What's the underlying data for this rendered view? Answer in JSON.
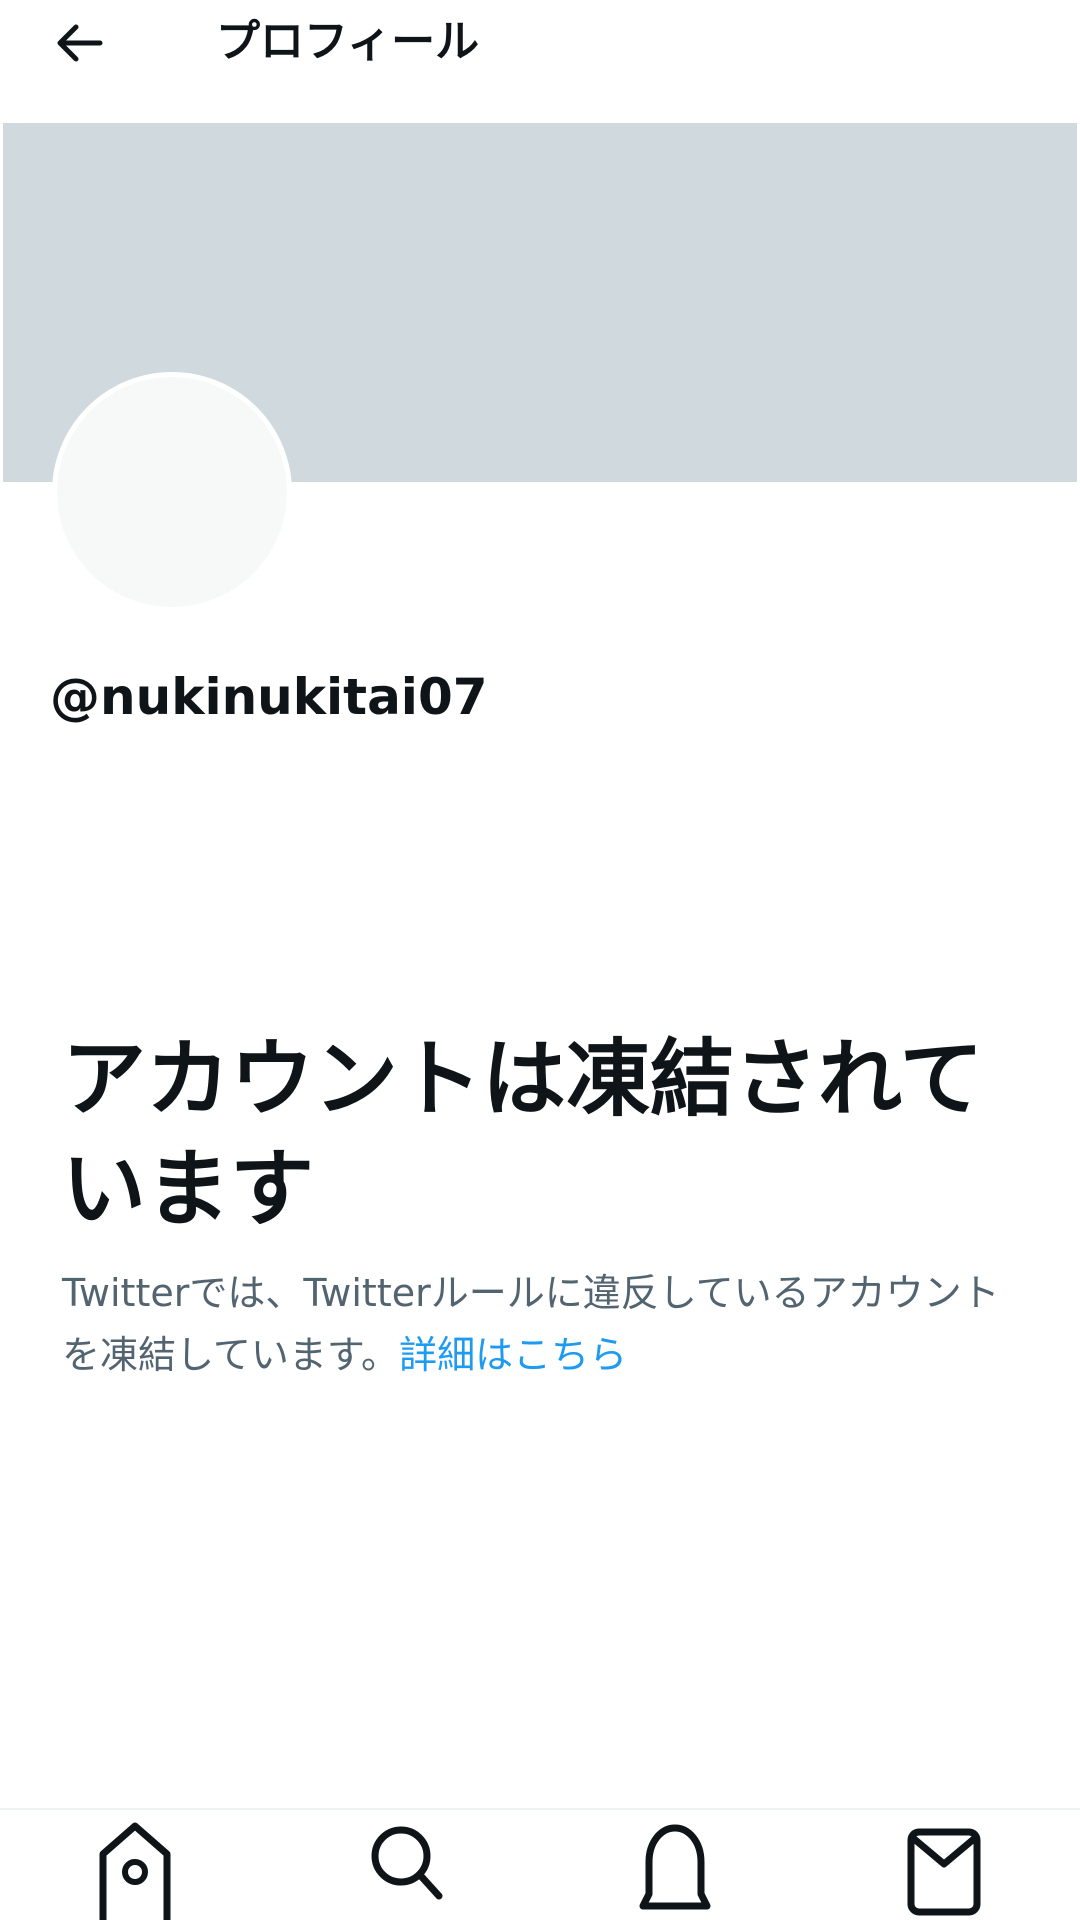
{
  "header": {
    "back_icon": "arrow-left-icon",
    "title": "プロフィール"
  },
  "profile": {
    "handle": "@nukinukitai07"
  },
  "suspension": {
    "title": "アカウントは凍結されています",
    "description": "Twitterでは、Twitterルールに違反しているアカウントを凍結しています。",
    "link_label": "詳細はこちら"
  },
  "bottom_nav": {
    "items": [
      {
        "icon": "home-icon"
      },
      {
        "icon": "search-icon"
      },
      {
        "icon": "bell-icon"
      },
      {
        "icon": "mail-icon"
      }
    ]
  },
  "colors": {
    "banner": "#cfd9de",
    "text_primary": "#0f1419",
    "text_secondary": "#536471",
    "link": "#1d9bf0"
  }
}
